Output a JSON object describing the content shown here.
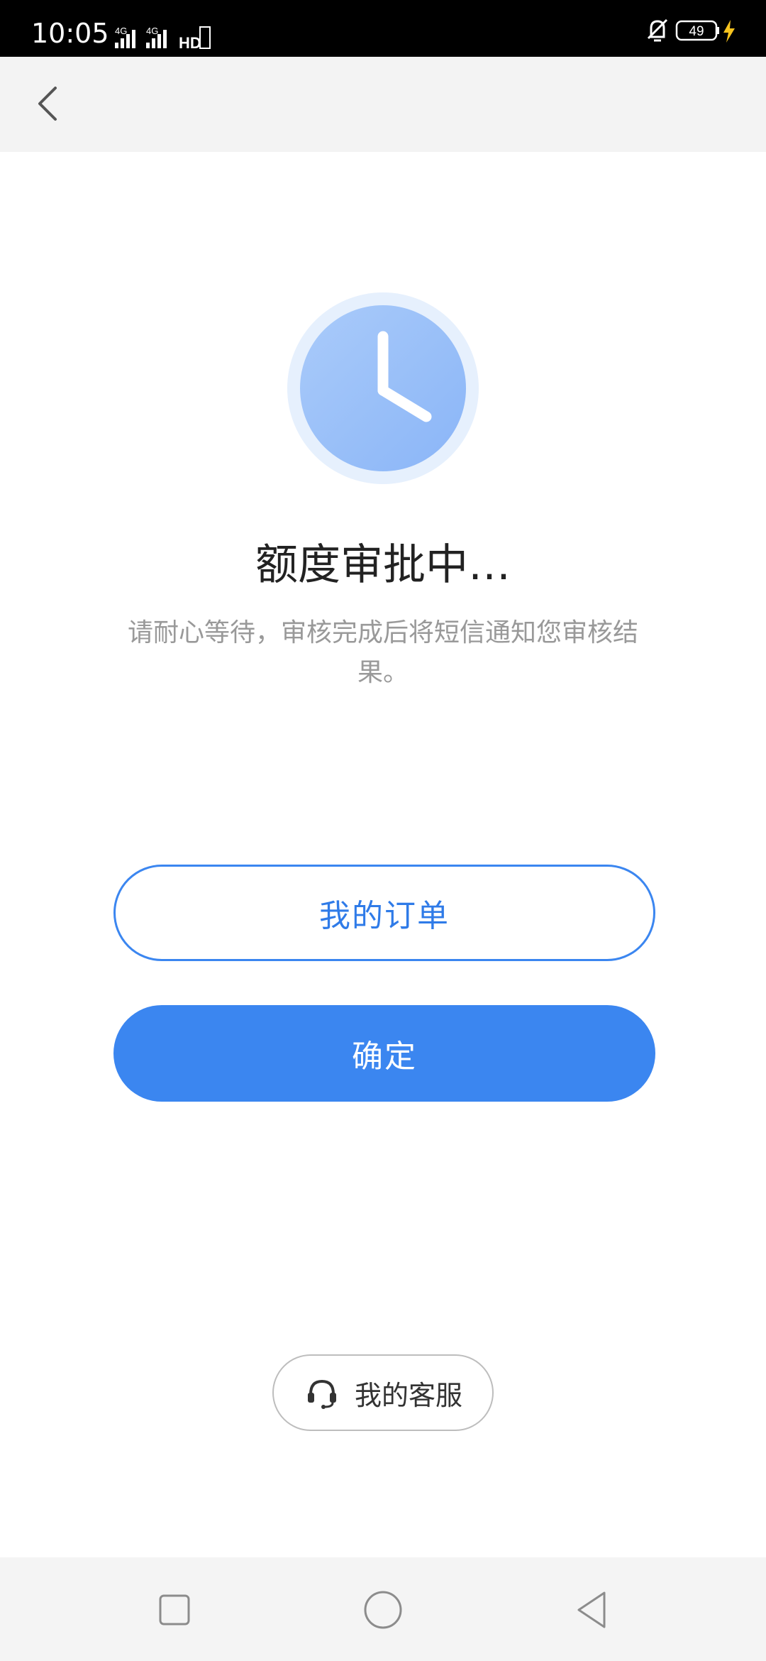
{
  "status_bar": {
    "time": "10:05",
    "network_1": "4G",
    "network_2": "4G",
    "hd_label": "HD",
    "battery_level": "49"
  },
  "nav": {
    "back_icon": "chevron-left-icon"
  },
  "status_card": {
    "icon": "clock-icon",
    "title": "额度审批中…",
    "message": "请耐心等待，审核完成后将短信通知您审核结果。"
  },
  "actions": {
    "my_orders_label": "我的订单",
    "confirm_label": "确定"
  },
  "customer_service": {
    "icon": "headset-icon",
    "label": "我的客服"
  },
  "colors": {
    "accent": "#3b86f0",
    "title_text": "#222222",
    "subtitle_text": "#999999"
  }
}
